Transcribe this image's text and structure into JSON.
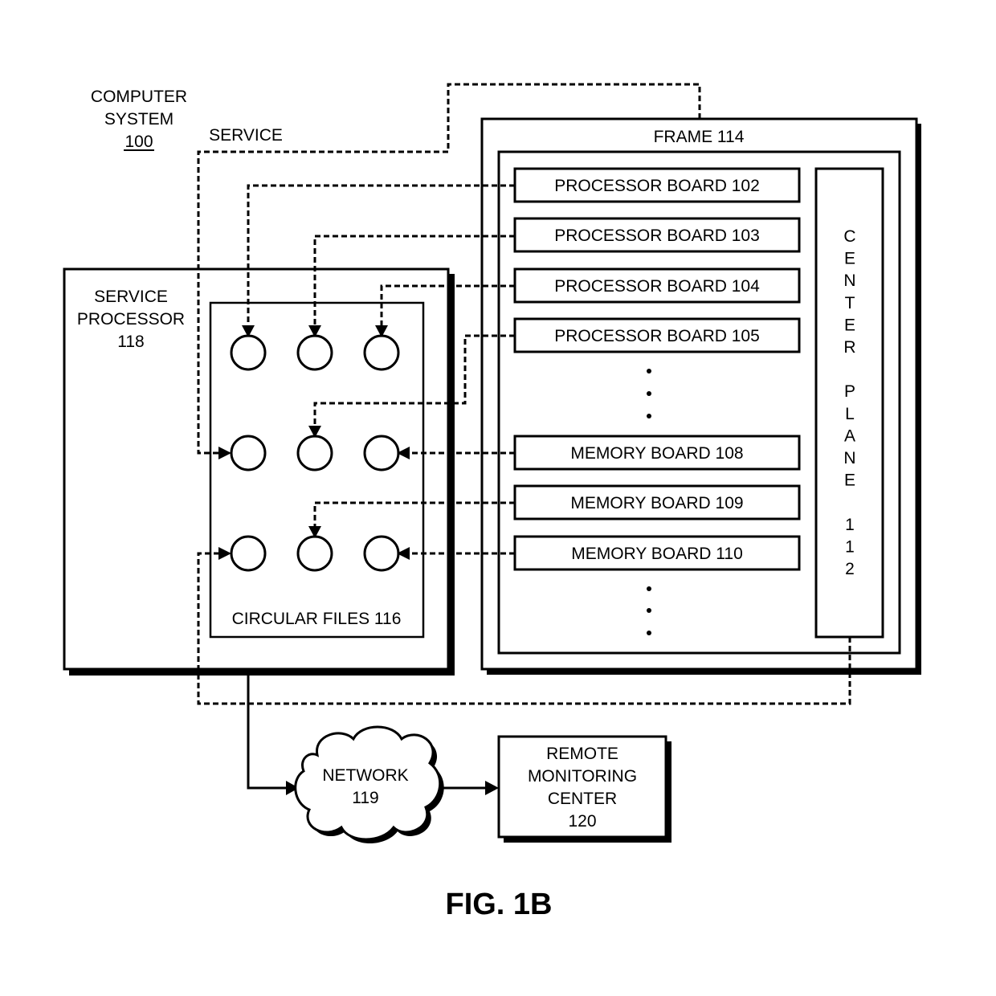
{
  "figure": {
    "title": "FIG. 1B",
    "computer_system": {
      "line1": "COMPUTER",
      "line2": "SYSTEM",
      "ref": "100"
    },
    "service_label": "SERVICE",
    "service_processor": {
      "line1": "SERVICE",
      "line2": "PROCESSOR",
      "ref": "118"
    },
    "circular_files": {
      "label": "CIRCULAR FILES  116",
      "rows": 3,
      "cols": 3
    },
    "frame": {
      "label": "FRAME  114"
    },
    "boards": [
      {
        "label": "PROCESSOR BOARD  102",
        "type": "processor"
      },
      {
        "label": "PROCESSOR BOARD  103",
        "type": "processor"
      },
      {
        "label": "PROCESSOR BOARD  104",
        "type": "processor"
      },
      {
        "label": "PROCESSOR BOARD  105",
        "type": "processor"
      },
      {
        "label": "MEMORY BOARD  108",
        "type": "memory"
      },
      {
        "label": "MEMORY BOARD  109",
        "type": "memory"
      },
      {
        "label": "MEMORY BOARD  110",
        "type": "memory"
      }
    ],
    "center_plane": {
      "letters": [
        "C",
        "E",
        "N",
        "T",
        "E",
        "R",
        "",
        "P",
        "L",
        "A",
        "N",
        "E",
        "",
        "1",
        "1",
        "2"
      ]
    },
    "network": {
      "line1": "NETWORK",
      "line2": "119"
    },
    "remote_monitoring": {
      "line1": "REMOTE",
      "line2": "MONITORING",
      "line3": "CENTER",
      "ref": "120"
    },
    "ellipsis": "•"
  }
}
